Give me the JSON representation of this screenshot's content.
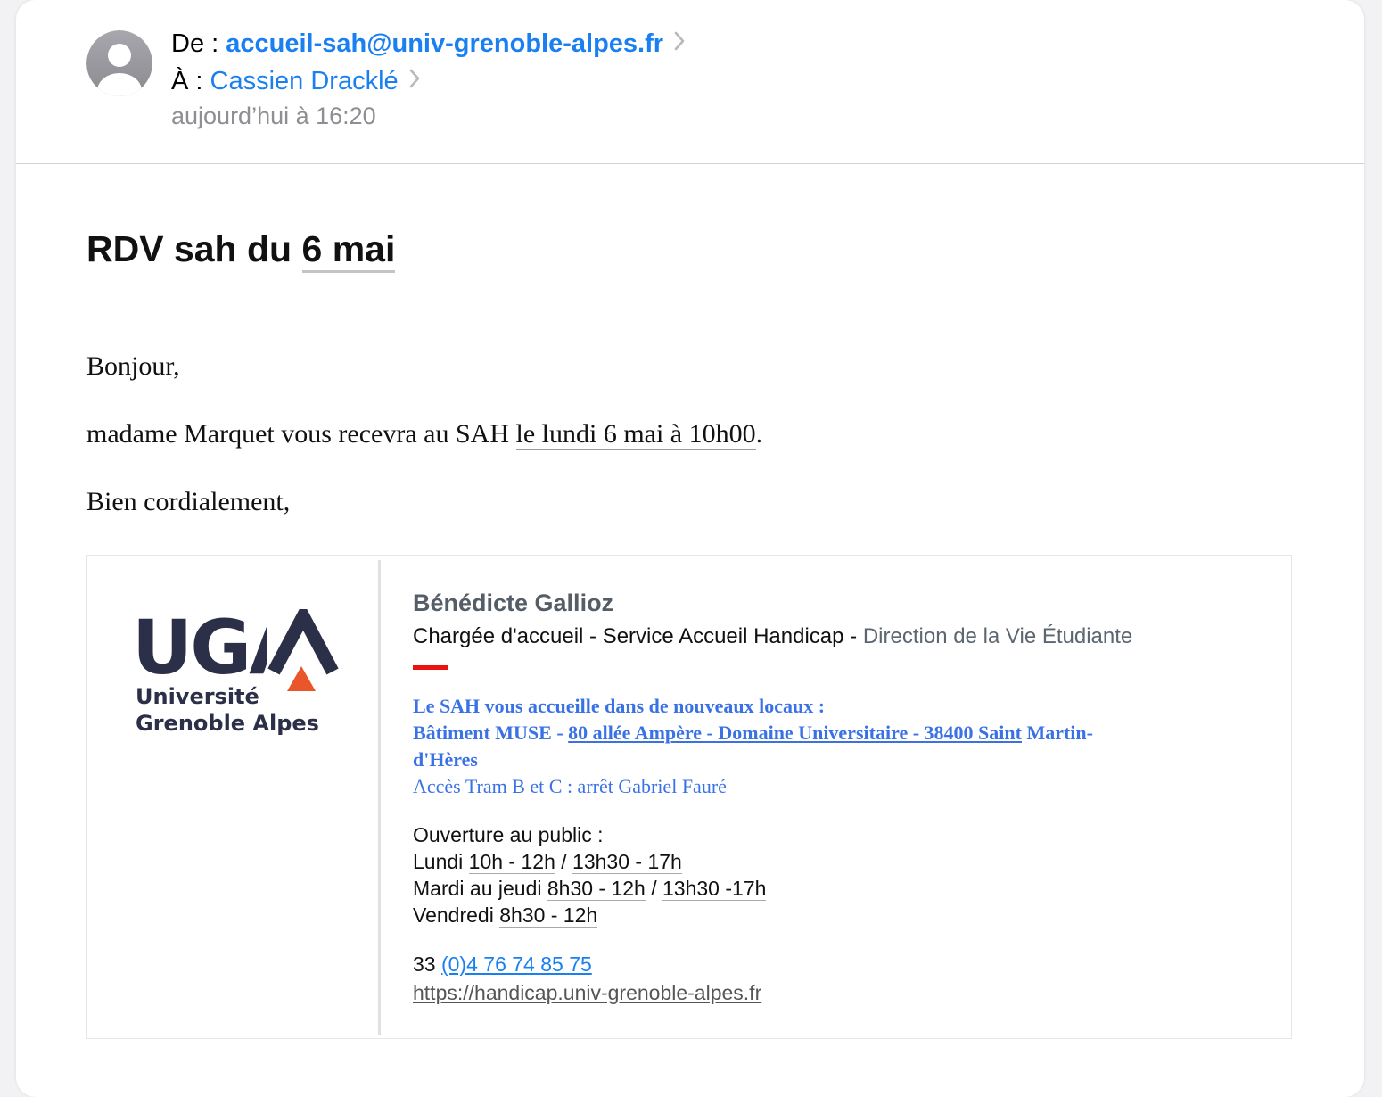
{
  "header": {
    "from_label": "De :",
    "from_address": "accueil-sah@univ-grenoble-alpes.fr",
    "to_label": "À :",
    "to_name": "Cassien Dracklé",
    "date": "aujourd’hui à 16:20",
    "avatar_icon": "person-avatar-icon",
    "chevron_icon": "chevron-right-icon"
  },
  "subject": {
    "prefix": "RDV sah du",
    "date_link": "6 mai"
  },
  "body": {
    "greeting": "Bonjour,",
    "line_prefix": "madame Marquet vous recevra au SAH",
    "line_date": "le lundi 6 mai à 10h00",
    "line_suffix": ".",
    "closing": "Bien cordialement,"
  },
  "signature": {
    "logo": {
      "letters": "UGA",
      "line1": "Université",
      "line2": "Grenoble Alpes"
    },
    "name": "Bénédicte Gallioz",
    "role": "Chargée d'accueil - Service Accueil Handicap",
    "role_sep": " - ",
    "direction": "Direction de la Vie Étudiante",
    "announce": "Le SAH vous accueille dans de nouveaux locaux :",
    "address_prefix": "Bâtiment MUSE - ",
    "address_link": "80 allée Ampère - Domaine Universitaire - 38400 Saint",
    "address_suffix": " Martin-",
    "address_line2": "d'Hères",
    "access": "Accès Tram B et C : arrêt Gabriel Fauré",
    "hours_title": "Ouverture au public :",
    "hours": [
      {
        "day": "Lundi ",
        "t1": "10h - 12h",
        "mid": " / ",
        "t2": "13h30 - 17h"
      },
      {
        "day": "Mardi au jeudi ",
        "t1": "8h30 - 12h",
        "mid": " / ",
        "t2": "13h30 -17h"
      },
      {
        "day": "Vendredi ",
        "t1": "8h30 - 12h",
        "mid": "",
        "t2": ""
      }
    ],
    "phone_prefix": "33 ",
    "phone_link": "(0)4 76 74 85 75",
    "website": "https://handicap.univ-grenoble-alpes.fr"
  },
  "colors": {
    "link_blue": "#1a7ff0",
    "signature_blue": "#3a72e6",
    "brand_navy": "#2b3048",
    "brand_orange": "#e8562a",
    "accent_red": "#ee1111"
  }
}
